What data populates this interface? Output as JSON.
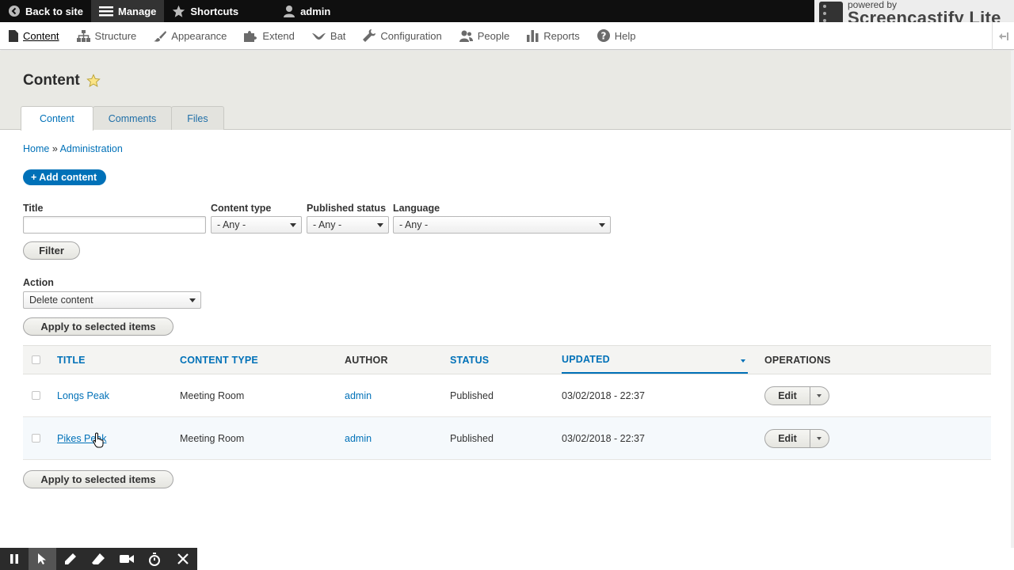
{
  "toolbar": {
    "back": "Back to site",
    "manage": "Manage",
    "shortcuts": "Shortcuts",
    "user": "admin"
  },
  "watermark": {
    "small": "powered by",
    "big": "Screencastify Lite"
  },
  "menu": {
    "items": [
      "Content",
      "Structure",
      "Appearance",
      "Extend",
      "Bat",
      "Configuration",
      "People",
      "Reports",
      "Help"
    ]
  },
  "page": {
    "title": "Content",
    "tabs": [
      "Content",
      "Comments",
      "Files"
    ]
  },
  "breadcrumb": {
    "home": "Home",
    "separator": "»",
    "admin": "Administration"
  },
  "add_content": "+ Add content",
  "filters": {
    "title_label": "Title",
    "title_value": "",
    "content_type_label": "Content type",
    "content_type_value": "- Any -",
    "published_label": "Published status",
    "published_value": "- Any -",
    "language_label": "Language",
    "language_value": "- Any -",
    "filter_button": "Filter"
  },
  "action": {
    "label": "Action",
    "value": "Delete content",
    "apply": "Apply to selected items"
  },
  "table": {
    "headers": [
      "TITLE",
      "CONTENT TYPE",
      "AUTHOR",
      "STATUS",
      "UPDATED",
      "OPERATIONS"
    ],
    "rows": [
      {
        "title": "Longs Peak",
        "type": "Meeting Room",
        "author": "admin",
        "status": "Published",
        "updated": "03/02/2018 - 22:37",
        "op": "Edit"
      },
      {
        "title": "Pikes Peak",
        "type": "Meeting Room",
        "author": "admin",
        "status": "Published",
        "updated": "03/02/2018 - 22:37",
        "op": "Edit"
      }
    ]
  },
  "colors": {
    "link": "#0071b8",
    "toolbar_bg": "#0f0f0f",
    "header_bg": "#e9e9e4"
  }
}
